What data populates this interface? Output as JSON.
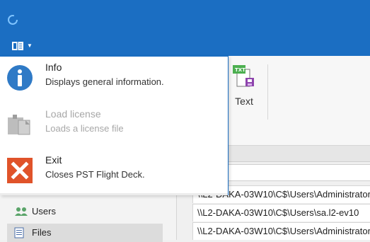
{
  "app_menu": {
    "items": [
      {
        "title": "Info",
        "description": "Displays general information.",
        "icon": "info-icon",
        "enabled": true
      },
      {
        "title": "Load license",
        "description": "Loads a license file",
        "icon": "license-icon",
        "enabled": false
      },
      {
        "title": "Exit",
        "description": "Closes PST Flight Deck.",
        "icon": "exit-icon",
        "enabled": true
      }
    ]
  },
  "ribbon": {
    "text_button_label": "Text"
  },
  "sidebar": {
    "items": [
      {
        "label": "Users",
        "icon": "users-icon"
      },
      {
        "label": "Files",
        "icon": "files-icon"
      }
    ]
  },
  "file_list": {
    "rows": [
      "\\\\L2-DAKA-03W10\\C$\\Users\\Administrator",
      "\\\\L2-DAKA-03W10\\C$\\Users\\sa.l2-ev10",
      "\\\\L2-DAKA-03W10\\C$\\Users\\Administrator"
    ]
  },
  "colors": {
    "title_bar": "#1b6ec2",
    "exit_icon": "#e0532a",
    "info_icon": "#2f7ac6"
  }
}
